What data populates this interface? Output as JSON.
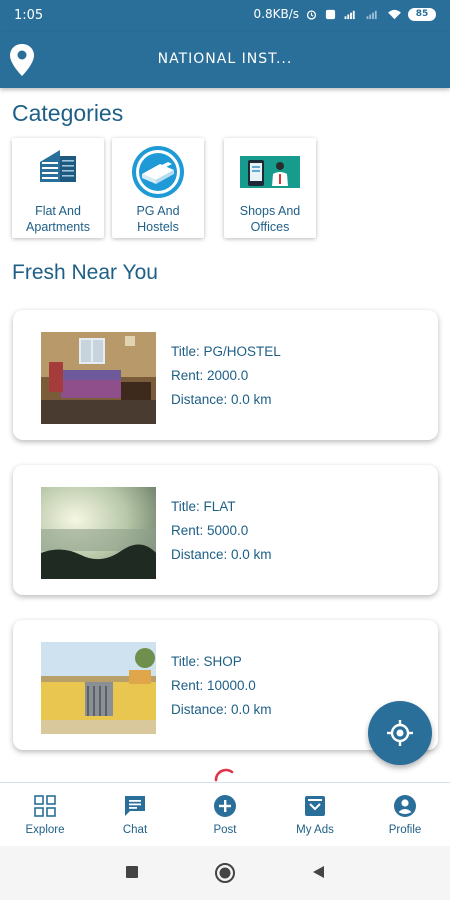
{
  "status_bar": {
    "time": "1:05",
    "network_speed": "0.8KB/s",
    "battery": "85"
  },
  "app_bar": {
    "title": "NATIONAL INST..."
  },
  "categories": {
    "heading": "Categories",
    "items": [
      {
        "label": "Flat And\nApartments",
        "icon": "building-icon"
      },
      {
        "label": "PG And\nHostels",
        "icon": "bed-icon"
      },
      {
        "label": "Shops And\nOffices",
        "icon": "shop-icon"
      }
    ]
  },
  "fresh": {
    "heading": "Fresh Near You",
    "listings": [
      {
        "title": "Title: PG/HOSTEL",
        "rent": "Rent: 2000.0",
        "distance": "Distance: 0.0  km"
      },
      {
        "title": "Title: FLAT",
        "rent": "Rent: 5000.0",
        "distance": "Distance: 0.0  km"
      },
      {
        "title": "Title: SHOP",
        "rent": "Rent: 10000.0",
        "distance": "Distance: 0.0  km"
      }
    ]
  },
  "bottom_nav": {
    "items": [
      {
        "label": "Explore",
        "icon": "grid-icon"
      },
      {
        "label": "Chat",
        "icon": "chat-icon"
      },
      {
        "label": "Post",
        "icon": "add-circle-icon"
      },
      {
        "label": "My Ads",
        "icon": "inbox-icon"
      },
      {
        "label": "Profile",
        "icon": "account-icon"
      }
    ]
  },
  "colors": {
    "primary": "#2a6f9a",
    "text": "#1e5f86",
    "accent": "#e0344a"
  }
}
